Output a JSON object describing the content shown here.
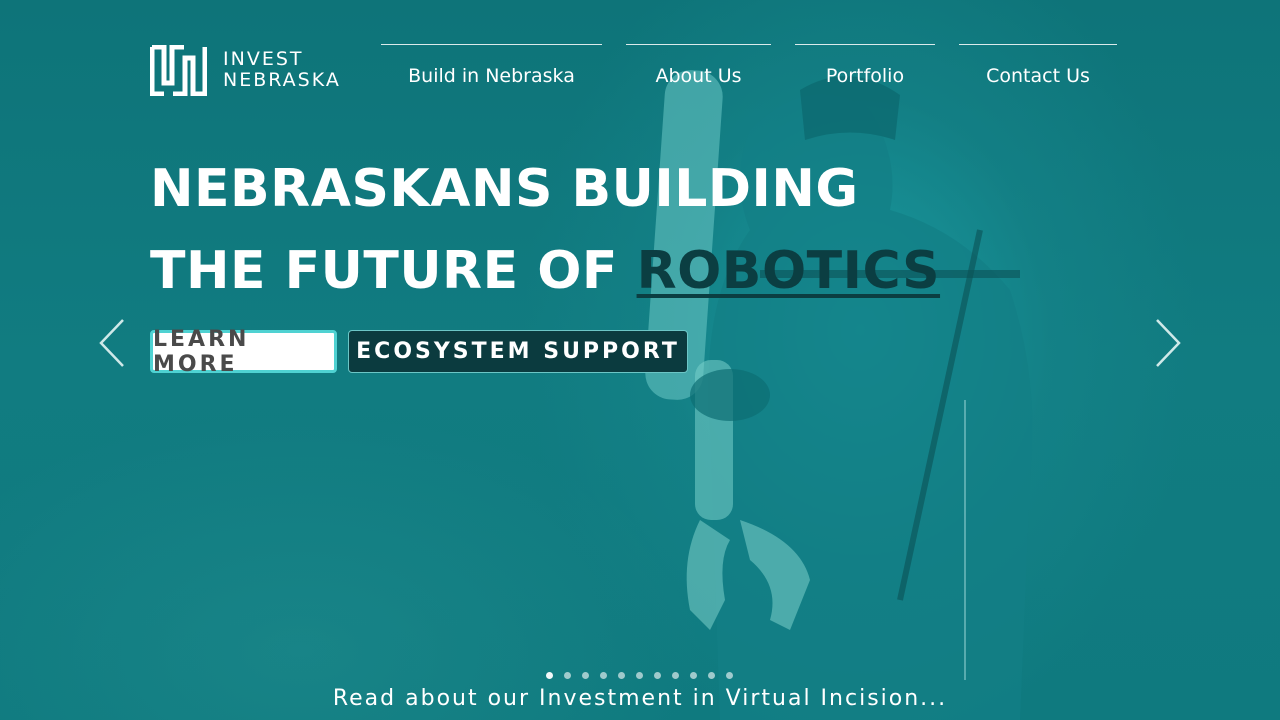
{
  "logo": {
    "line1": "INVEST",
    "line2": "NEBRASKA"
  },
  "nav": {
    "items": [
      {
        "label": "Build in Nebraska"
      },
      {
        "label": "About Us"
      },
      {
        "label": "Portfolio"
      },
      {
        "label": "Contact Us"
      }
    ]
  },
  "hero": {
    "headline_line1": "NEBRASKANS BUILDING",
    "headline_line2_prefix": "THE FUTURE OF ",
    "headline_accent": "ROBOTICS",
    "learn_more": "LEARN MORE",
    "ecosystem_support": "ECOSYSTEM SUPPORT",
    "caption": "Read about our Investment in Virtual Incision..."
  },
  "slider": {
    "slide_count": 11,
    "active_index": 0
  },
  "colors": {
    "background": "#0f7a7f",
    "accent_dark": "#0b3e42",
    "button_border": "#4fd2d2",
    "button_dark": "#0b3b3f"
  },
  "icons": {
    "prev": "chevron-left-icon",
    "next": "chevron-right-icon",
    "logo": "invest-nebraska-logo-mark"
  }
}
